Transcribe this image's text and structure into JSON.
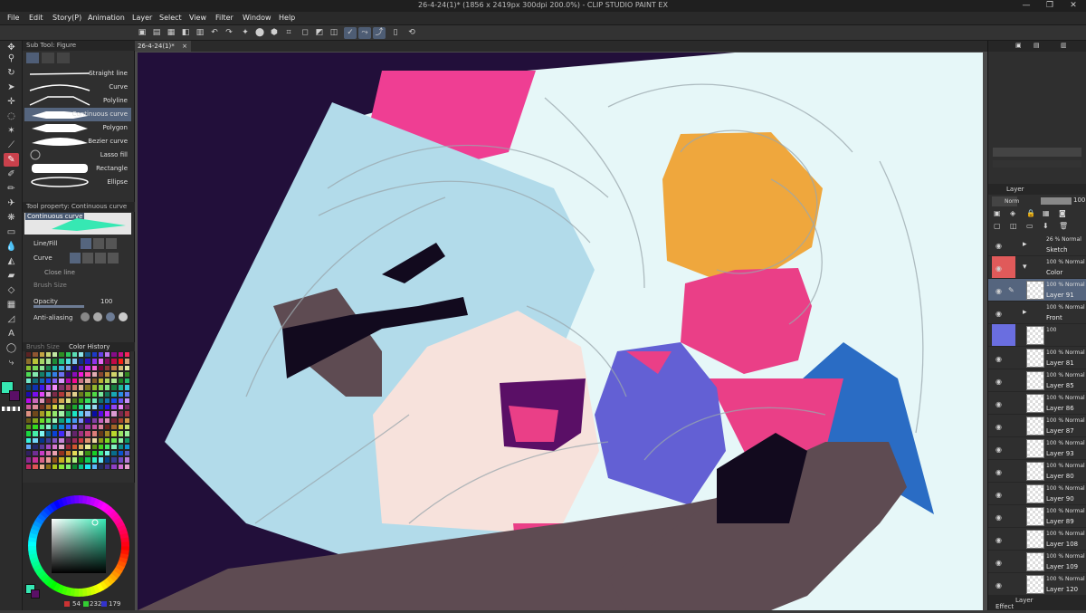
{
  "title": "26-4-24(1)* (1856 x 2419px 300dpi 200.0%) - CLIP STUDIO PAINT EX",
  "window_controls": [
    "—",
    "❐",
    "✕"
  ],
  "menu": [
    "File",
    "Edit",
    "Story(P)",
    "Animation",
    "Layer",
    "Select",
    "View",
    "Filter",
    "Window",
    "Help"
  ],
  "document_tab": {
    "label": "26-4-24(1)*",
    "close": "×"
  },
  "subtool_panel": {
    "header": "Sub Tool: Figure",
    "items": [
      "Straight line",
      "Curve",
      "Polyline",
      "Continuous curve",
      "Polygon",
      "Bezier curve",
      "Lasso fill",
      "Rectangle",
      "Ellipse"
    ],
    "selected_index": 3
  },
  "tool_property": {
    "header": "Tool property: Continuous curve",
    "preset": "Continuous curve",
    "rows": [
      {
        "label": "Line/Fill"
      },
      {
        "label": "Curve"
      },
      {
        "label": "Close line"
      },
      {
        "label": "Brush Size"
      },
      {
        "label": "Opacity",
        "value": "100"
      },
      {
        "label": "Anti-aliasing"
      }
    ]
  },
  "palette_panel": {
    "tab1": "Brush Size",
    "tab2": "Color History"
  },
  "color": {
    "r": "54",
    "g": "232",
    "b": "179",
    "main_hex": "#36e8b3",
    "sub_hex": "#5a0f66"
  },
  "layer_panel": {
    "header": "Layer",
    "blend_mode": "Norm",
    "opacity": "100",
    "effect_label": "Effect",
    "bottom_tab": "Layer",
    "layers": [
      {
        "mode": "26 % Normal",
        "name": "Sketch",
        "type": "folder"
      },
      {
        "mode": "100 % Normal",
        "name": "Color",
        "type": "folder",
        "flag": "red"
      },
      {
        "mode": "100 % Normal",
        "name": "Layer 91",
        "type": "layer",
        "selected": true
      },
      {
        "mode": "100 % Normal",
        "name": "Front",
        "type": "folder"
      },
      {
        "mode": "100",
        "name": "",
        "type": "layer",
        "flag": "blue"
      },
      {
        "mode": "100 % Normal",
        "name": "Layer 81",
        "type": "layer"
      },
      {
        "mode": "100 % Normal",
        "name": "Layer 85",
        "type": "layer"
      },
      {
        "mode": "100 % Normal",
        "name": "Layer 86",
        "type": "layer"
      },
      {
        "mode": "100 % Normal",
        "name": "Layer 87",
        "type": "layer"
      },
      {
        "mode": "100 % Normal",
        "name": "Layer 93",
        "type": "layer"
      },
      {
        "mode": "100 % Normal",
        "name": "Layer 80",
        "type": "layer"
      },
      {
        "mode": "100 % Normal",
        "name": "Layer 90",
        "type": "layer"
      },
      {
        "mode": "100 % Normal",
        "name": "Layer 89",
        "type": "layer"
      },
      {
        "mode": "100 % Normal",
        "name": "Layer 108",
        "type": "layer"
      },
      {
        "mode": "100 % Normal",
        "name": "Layer 109",
        "type": "layer"
      },
      {
        "mode": "100 % Normal",
        "name": "Layer 120",
        "type": "layer"
      }
    ]
  },
  "artwork_colors": {
    "background": "#220f3a",
    "hair": "#b2dbea",
    "skin": "#f7e2dc",
    "white_shape": "#e6f7f8",
    "pink": "#ef3e93",
    "orange": "#efa73d",
    "hot_pink": "#ea3f87",
    "blue": "#2a6cc4",
    "violet": "#6360d4",
    "brown": "#5e4b52"
  }
}
